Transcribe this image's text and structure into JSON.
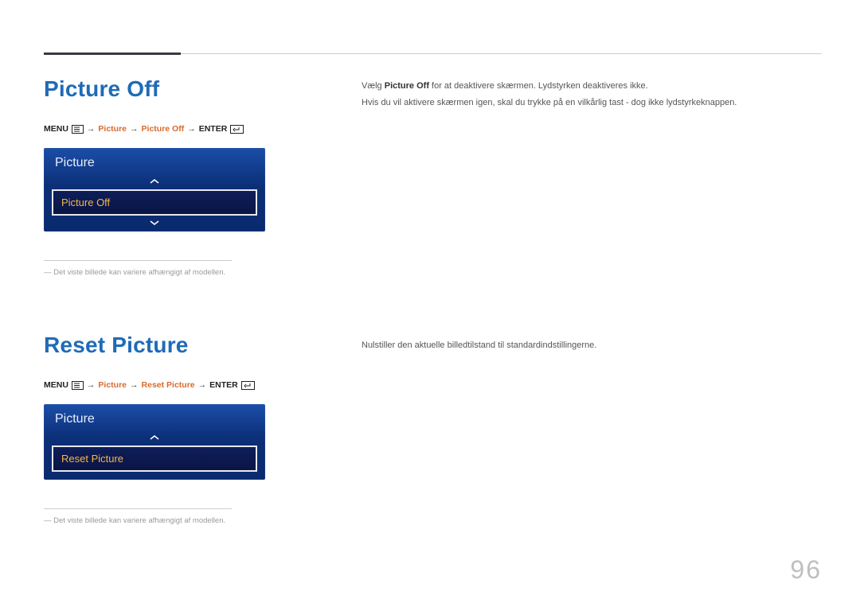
{
  "pageNumber": "96",
  "section1": {
    "title": "Picture Off",
    "breadcrumb": {
      "menu": "MENU",
      "picture": "Picture",
      "pictureOff": "Picture Off",
      "enter": "ENTER"
    },
    "panel": {
      "header": "Picture",
      "selected": "Picture Off"
    },
    "footnote": "Det viste billede kan variere afhængigt af modellen.",
    "body": {
      "line1_pre": "Vælg ",
      "line1_bold": "Picture Off",
      "line1_post": " for at deaktivere skærmen. Lydstyrken deaktiveres ikke.",
      "line2": "Hvis du vil aktivere skærmen igen, skal du trykke på en vilkårlig tast - dog ikke lydstyrkeknappen."
    }
  },
  "section2": {
    "title": "Reset Picture",
    "breadcrumb": {
      "menu": "MENU",
      "picture": "Picture",
      "resetPicture": "Reset Picture",
      "enter": "ENTER"
    },
    "panel": {
      "header": "Picture",
      "selected": "Reset Picture"
    },
    "footnote": "Det viste billede kan variere afhængigt af modellen.",
    "body": "Nulstiller den aktuelle billedtilstand til standardindstillingerne."
  }
}
